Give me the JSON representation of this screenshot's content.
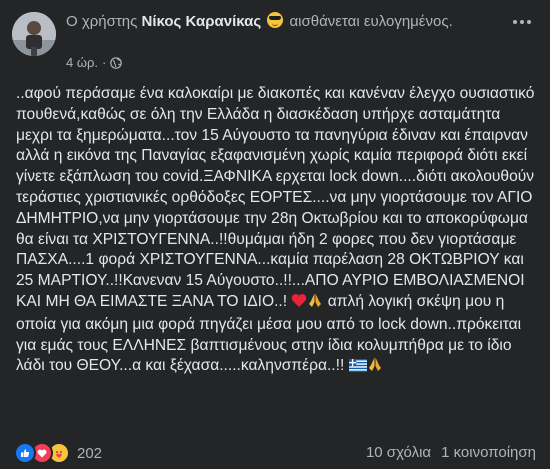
{
  "post": {
    "author": {
      "prefix": "Ο χρήστης",
      "name": "Νίκος Καρανίκας",
      "feeling": "αισθάνεται ευλογημένος."
    },
    "time": "4 ώρ.",
    "privacy_icon": "globe-icon",
    "body": [
      "..αφού περάσαμε ένα καλοκαίρι με διακοπές και κανέναν έλεγχο ουσιαστικό πουθενά,καθώς σε όλη την Ελλάδα η διασκέδαση υπήρχε ασταμάτητα μεχρι τα ξημερώματα...τον 15 Αύγουστο τα πανηγύρια έδιναν και έπαιρναν αλλά η εικόνα της Παναγίας εξαφανισμένη χωρίς καμία περιφορά διότι εκεί γίνετε εξάπλωση του covid.ΞΑΦΝΙΚΑ ερχεται lock down....διότι ακολουθούν τεράστιες χριστιανικές ορθόδοξες ΕΟΡΤΕΣ....να μην γιορτάσουμε τον ΑΓΙΟ ΔΗΜΗΤΡΙΟ,να μην γιορτάσουμε την 28η Οκτωβρίου και το αποκορύφωμα θα είναι τα ΧΡΙΣΤΟΥΓΕΝΝΑ..!!θυμάμαι  ήδη 2 φορες που δεν γιορτάσαμε ΠΑΣΧΑ....1 φορά ΧΡΙΣΤΟΥΓΕΝΝΑ...καμία παρέλαση 28 ΟΚΤΩΒΡΙΟΥ και 25 ΜΑΡΤΙΟΥ..!!Κανεναν 15 Αύγουστο..!!...ΑΠΟ ΑΥΡΙΟ ΕΜΒΟΛΙΑΣΜΕΝΟΙ ΚΑΙ ΜΗ ΘΑ ΕΙΜΑΣΤΕ ΞΑΝΑ ΤΟ ΙΔΙΟ..!",
      "απλή λογική σκέψη μου η οποία για ακόμη μια φορά πηγάζει μέσα μου από το lock down..πρόκειται για εμάς τους ΕΛΛΗΝΕΣ βαπτισμένους στην ίδια κολυμπήθρα με το ίδιο λάδι του ΘΕΟΥ...α και ξέχασα.....καληνσπέρα..!!"
    ],
    "reactions_count": "202",
    "comments": "10 σχόλια",
    "shares": "1 κοινοποίηση",
    "colors": {
      "background": "#242526",
      "text": "#e4e6eb",
      "secondary": "#b0b3b8",
      "like": "#1877f2",
      "love": "#f33e58"
    }
  }
}
